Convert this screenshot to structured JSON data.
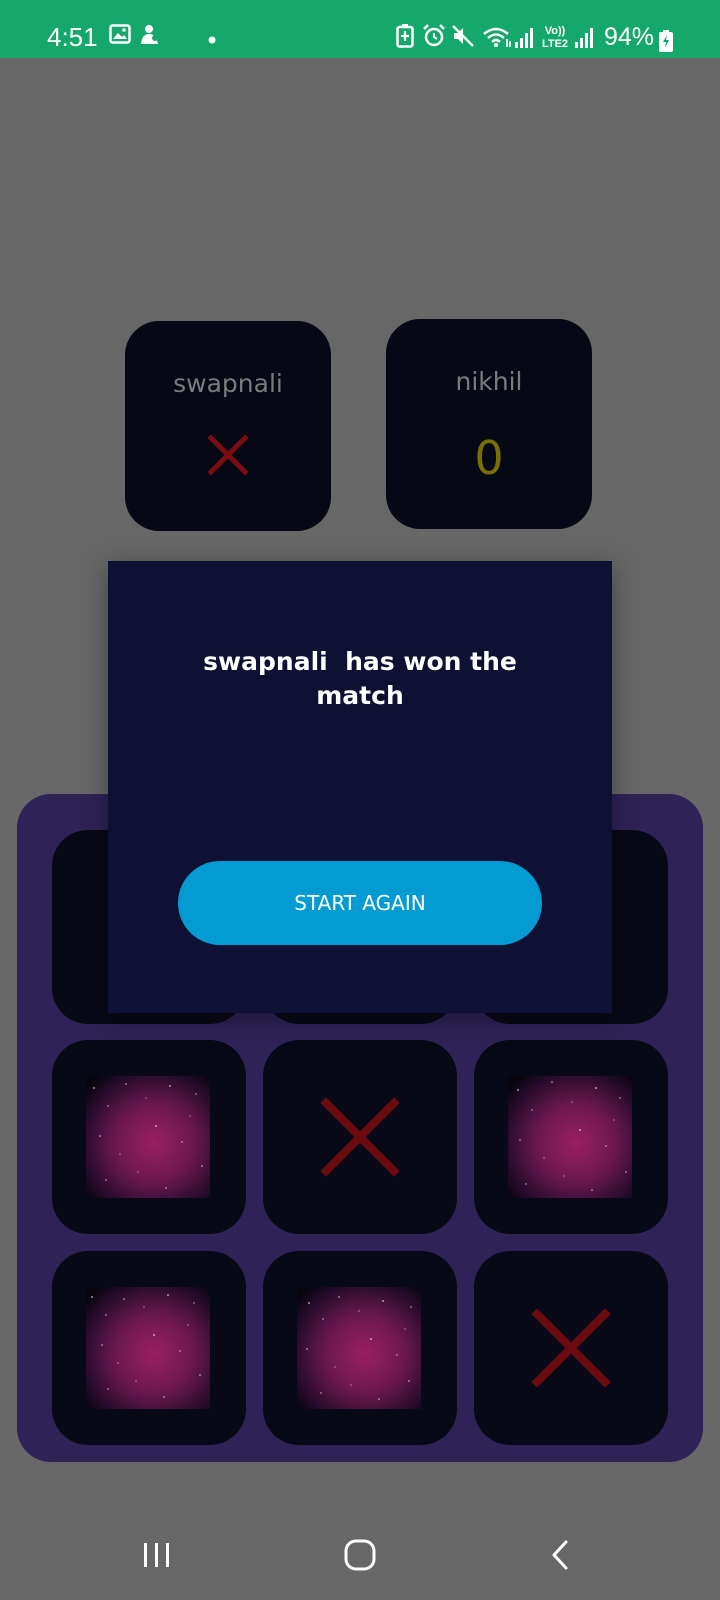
{
  "status_bar": {
    "time": "4:51",
    "battery_percent": "94%",
    "icons": [
      "gallery-icon",
      "notification-app-icon",
      "dot-icon",
      "battery-saver-icon",
      "alarm-icon",
      "mute-icon",
      "wifi-icon",
      "signal-icon",
      "volte-lte2-icon",
      "signal-2-icon",
      "charging-battery-icon"
    ],
    "volte_label_top": "Vo))",
    "volte_label_bottom": "LTE2",
    "color": "#14a86a"
  },
  "players": [
    {
      "name": "swapnali",
      "mark": "x",
      "mark_color": "#7a0d12"
    },
    {
      "name": "nikhil",
      "score": "0",
      "score_color": "#787102"
    }
  ],
  "board": {
    "background": "#2e2256",
    "cells": [
      "hidden",
      "hidden",
      "hidden",
      "galaxy",
      "x",
      "galaxy",
      "galaxy",
      "galaxy",
      "x"
    ]
  },
  "dialog": {
    "message": "swapnali  has won the\nmatch",
    "button_label": "START AGAIN",
    "button_color": "#039bd1"
  },
  "nav_bar": {
    "items": [
      "recent-apps-icon",
      "home-icon",
      "back-icon"
    ]
  }
}
